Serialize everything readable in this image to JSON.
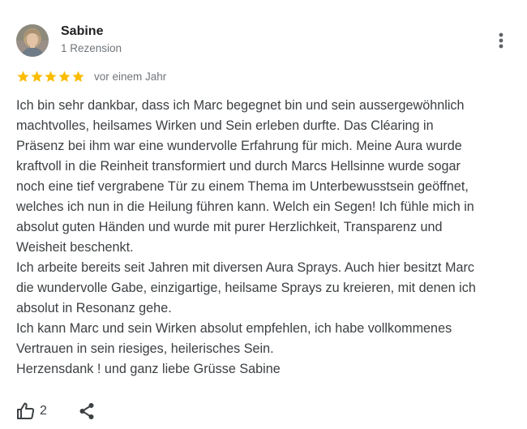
{
  "reviewer": {
    "name": "Sabine",
    "meta": "1 Rezension",
    "avatar": "reviewer-photo"
  },
  "rating": {
    "stars": 5,
    "max": 5,
    "date": "vor einem Jahr",
    "star_color": "#fbbc04"
  },
  "review": {
    "paragraphs": [
      "Ich bin sehr dankbar, dass ich Marc begegnet bin und sein aussergewöhnlich",
      "machtvolles, heilsames Wirken und Sein erleben durfte. Das Cléaring in",
      "Präsenz bei ihm war eine wundervolle Erfahrung für mich. Meine Aura wurde",
      "kraftvoll in die Reinheit transformiert und durch Marcs Hellsinne wurde sogar",
      "noch eine tief vergrabene Tür zu einem Thema im Unterbewusstsein geöffnet,",
      "welches ich nun in die Heilung führen kann. Welch ein Segen! Ich fühle mich in",
      "absolut guten Händen und wurde mit purer Herzlichkeit, Transparenz und",
      "Weisheit beschenkt.",
      "Ich arbeite bereits seit Jahren mit diversen Aura Sprays. Auch hier besitzt Marc",
      "die wundervolle Gabe, einzigartige, heilsame Sprays zu kreieren, mit denen ich",
      "absolut in Resonanz gehe.",
      "Ich kann Marc und sein Wirken absolut empfehlen, ich habe vollkommenes",
      "Vertrauen in sein riesiges, heilerisches Sein.",
      "Herzensdank ! und ganz liebe Grüsse Sabine"
    ]
  },
  "actions": {
    "like_count": "2",
    "like_icon": "thumbs-up-icon",
    "share_icon": "share-icon",
    "more_icon": "more-vert-icon"
  }
}
